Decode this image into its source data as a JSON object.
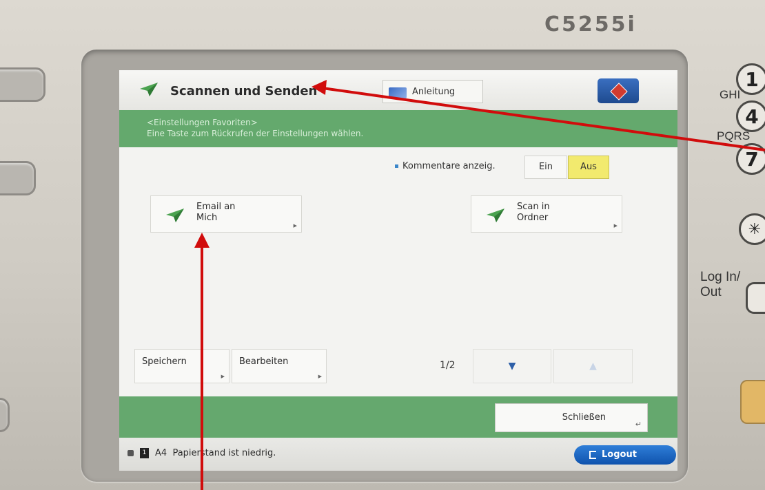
{
  "device": {
    "model": "C5255i",
    "keypad": [
      {
        "key": "1",
        "label": ""
      },
      {
        "key": "4",
        "label": "GHI"
      },
      {
        "key": "7",
        "label": "PQRS"
      },
      {
        "key": "✳",
        "label": ""
      }
    ],
    "login_label": "Log In/\nOut"
  },
  "screen": {
    "title": "Scannen und Senden",
    "guide_button": "Anleitung",
    "banner": {
      "line1": "<Einstellungen Favoriten>",
      "line2": "Eine Taste zum Rückrufen der Einstellungen wählen."
    },
    "comments": {
      "label": "Kommentare anzeig.",
      "on": "Ein",
      "off": "Aus",
      "selected": "Aus"
    },
    "favorites": [
      {
        "label": "Email an\nMich"
      },
      {
        "label": "Scan in\nOrdner"
      }
    ],
    "bottom": {
      "save": "Speichern",
      "edit": "Bearbeiten",
      "page_indicator": "1/2"
    },
    "close_button": "Schließen",
    "status": {
      "paper_size": "A4",
      "message": "Papierstand ist niedrig.",
      "logout": "Logout"
    }
  },
  "colors": {
    "green": "#65a86e",
    "selected_toggle": "#f2ea6e",
    "annotation_arrow": "#d10c0c",
    "logout_blue": "#1a64c0"
  }
}
